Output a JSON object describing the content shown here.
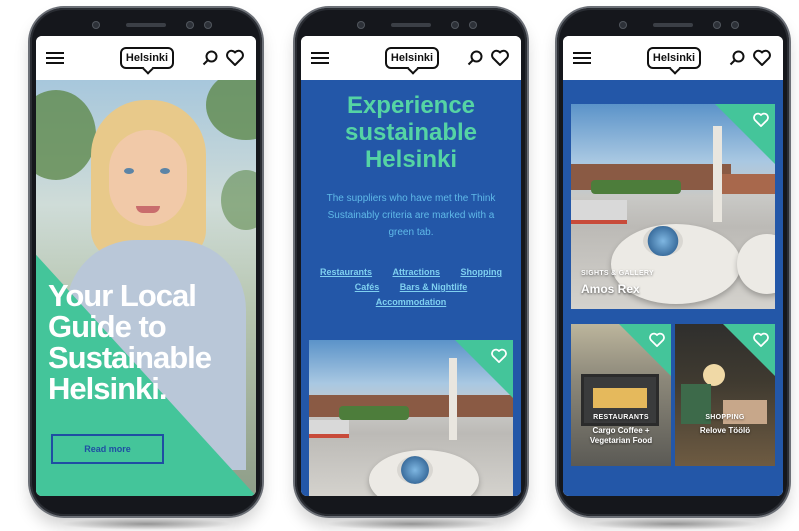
{
  "app": {
    "logo_text": "Helsinki"
  },
  "phone1": {
    "hero_title_lines": [
      "Your Local",
      "Guide to",
      "Sustainable",
      "Helsinki."
    ],
    "read_more_label": "Read more"
  },
  "phone2": {
    "title_lines": [
      "Experience",
      "sustainable",
      "Helsinki"
    ],
    "description": "The suppliers who have met the Think Sustainably criteria are marked with a green tab.",
    "links": [
      "Restaurants",
      "Attractions",
      "Shopping",
      "Cafés",
      "Bars & Nightlife",
      "Accommodation"
    ]
  },
  "phone3": {
    "featured": {
      "category": "SIGHTS & GALLERY",
      "title": "Amos Rex"
    },
    "cards": [
      {
        "category": "RESTAURANTS",
        "title_lines": [
          "Cargo Coffee +",
          "Vegetarian Food"
        ]
      },
      {
        "category": "SHOPPING",
        "title_lines": [
          "Relove Töölö"
        ]
      }
    ]
  },
  "colors": {
    "brand_green": "#44c59a",
    "brand_blue": "#2357a8",
    "link_blue": "#7fd0f0",
    "title_green": "#55d4a4"
  },
  "icons": [
    "hamburger-menu-icon",
    "search-icon",
    "heart-icon"
  ]
}
